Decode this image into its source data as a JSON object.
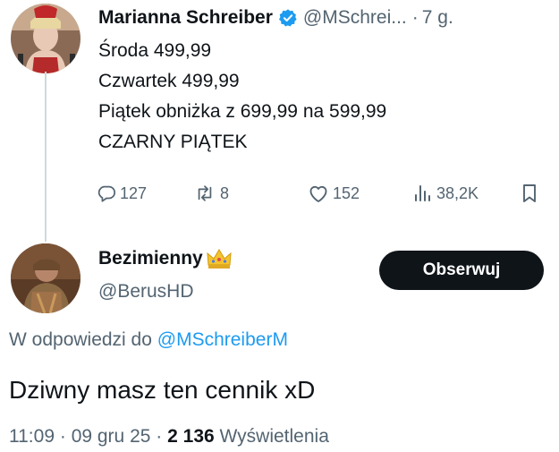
{
  "tweet1": {
    "author_name": "Marianna Schreiber",
    "author_handle": "@MSchrei...",
    "separator": "·",
    "time": "7 g.",
    "lines": [
      "Środa 499,99",
      "Czwartek 499,99",
      "Piątek obniżka z 699,99 na 599,99",
      "CZARNY PIĄTEK"
    ],
    "actions": {
      "replies": "127",
      "reposts": "8",
      "likes": "152",
      "views": "38,2K"
    }
  },
  "tweet2": {
    "author_name": "Bezimienny",
    "author_badge": "crown-emoji",
    "author_handle": "@BerusHD",
    "follow_label": "Obserwuj",
    "reply_prefix": "W odpowiedzi do",
    "reply_mention": "@MSchreiberM",
    "text": "Dziwny masz ten cennik xD",
    "time": "11:09",
    "separator": "·",
    "date": "09 gru 25",
    "view_count": "2 136",
    "views_label": "Wyświetlenia"
  },
  "colors": {
    "text": "#0f1419",
    "muted": "#536471",
    "link": "#1d9bf0",
    "verified": "#1d9bf0",
    "button_bg": "#0f1419"
  }
}
